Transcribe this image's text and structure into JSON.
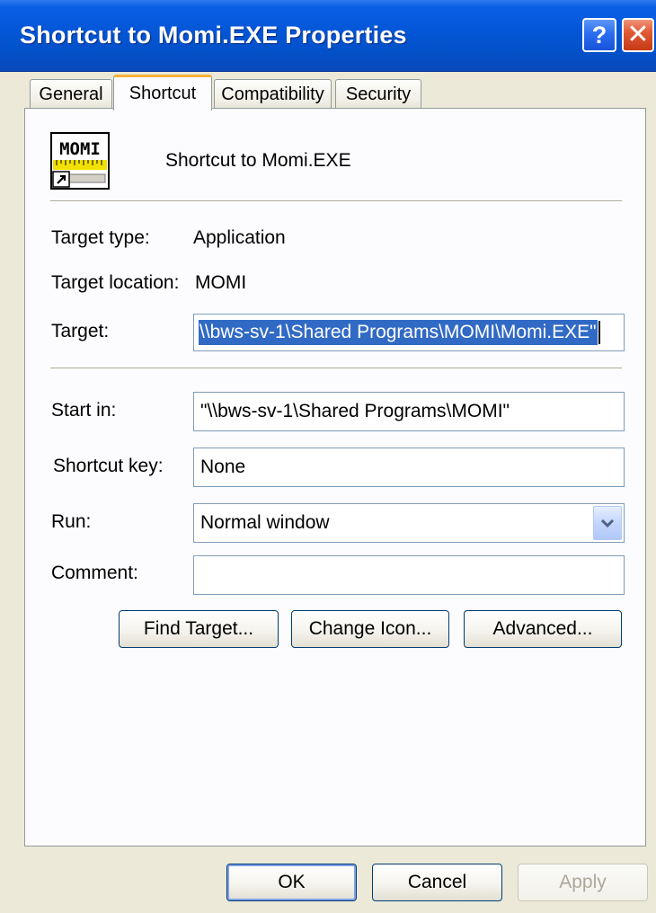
{
  "window": {
    "title": "Shortcut to Momi.EXE Properties",
    "help_glyph": "?",
    "close_glyph": "✕"
  },
  "tabs": [
    {
      "label": "General"
    },
    {
      "label": "Shortcut",
      "active": true
    },
    {
      "label": "Compatibility"
    },
    {
      "label": "Security"
    }
  ],
  "shortcut": {
    "icon": "momi-app-icon",
    "icon_text": "MOMI",
    "name": "Shortcut to Momi.EXE",
    "target_type_label": "Target type:",
    "target_type_value": "Application",
    "target_location_label": "Target location:",
    "target_location_value": "MOMI",
    "target_label": "Target:",
    "target_value": "\\\\bws-sv-1\\Shared Programs\\MOMI\\Momi.EXE\"",
    "start_in_label": "Start in:",
    "start_in_value": "\"\\\\bws-sv-1\\Shared Programs\\MOMI\"",
    "shortcut_key_label": "Shortcut key:",
    "shortcut_key_value": "None",
    "run_label": "Run:",
    "run_value": "Normal window",
    "comment_label": "Comment:",
    "comment_value": "",
    "find_target_button": "Find Target...",
    "change_icon_button": "Change Icon...",
    "advanced_button": "Advanced..."
  },
  "footer": {
    "ok_button": "OK",
    "cancel_button": "Cancel",
    "apply_button": "Apply"
  },
  "colors": {
    "titlebar": "#0456d6",
    "face": "#ece9d8",
    "selection": "#316ac5",
    "active_tab_accent": "#f7b13a"
  }
}
